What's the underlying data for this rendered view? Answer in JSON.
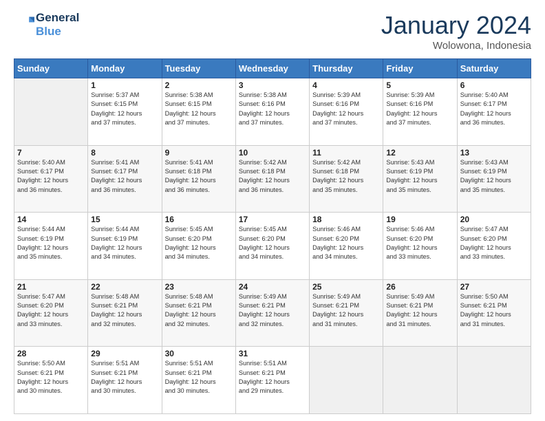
{
  "header": {
    "logo_line1": "General",
    "logo_line2": "Blue",
    "month_title": "January 2024",
    "location": "Wolowona, Indonesia"
  },
  "days_of_week": [
    "Sunday",
    "Monday",
    "Tuesday",
    "Wednesday",
    "Thursday",
    "Friday",
    "Saturday"
  ],
  "weeks": [
    [
      {
        "day": "",
        "info": ""
      },
      {
        "day": "1",
        "info": "Sunrise: 5:37 AM\nSunset: 6:15 PM\nDaylight: 12 hours\nand 37 minutes."
      },
      {
        "day": "2",
        "info": "Sunrise: 5:38 AM\nSunset: 6:15 PM\nDaylight: 12 hours\nand 37 minutes."
      },
      {
        "day": "3",
        "info": "Sunrise: 5:38 AM\nSunset: 6:16 PM\nDaylight: 12 hours\nand 37 minutes."
      },
      {
        "day": "4",
        "info": "Sunrise: 5:39 AM\nSunset: 6:16 PM\nDaylight: 12 hours\nand 37 minutes."
      },
      {
        "day": "5",
        "info": "Sunrise: 5:39 AM\nSunset: 6:16 PM\nDaylight: 12 hours\nand 37 minutes."
      },
      {
        "day": "6",
        "info": "Sunrise: 5:40 AM\nSunset: 6:17 PM\nDaylight: 12 hours\nand 36 minutes."
      }
    ],
    [
      {
        "day": "7",
        "info": "Sunrise: 5:40 AM\nSunset: 6:17 PM\nDaylight: 12 hours\nand 36 minutes."
      },
      {
        "day": "8",
        "info": "Sunrise: 5:41 AM\nSunset: 6:17 PM\nDaylight: 12 hours\nand 36 minutes."
      },
      {
        "day": "9",
        "info": "Sunrise: 5:41 AM\nSunset: 6:18 PM\nDaylight: 12 hours\nand 36 minutes."
      },
      {
        "day": "10",
        "info": "Sunrise: 5:42 AM\nSunset: 6:18 PM\nDaylight: 12 hours\nand 36 minutes."
      },
      {
        "day": "11",
        "info": "Sunrise: 5:42 AM\nSunset: 6:18 PM\nDaylight: 12 hours\nand 35 minutes."
      },
      {
        "day": "12",
        "info": "Sunrise: 5:43 AM\nSunset: 6:19 PM\nDaylight: 12 hours\nand 35 minutes."
      },
      {
        "day": "13",
        "info": "Sunrise: 5:43 AM\nSunset: 6:19 PM\nDaylight: 12 hours\nand 35 minutes."
      }
    ],
    [
      {
        "day": "14",
        "info": "Sunrise: 5:44 AM\nSunset: 6:19 PM\nDaylight: 12 hours\nand 35 minutes."
      },
      {
        "day": "15",
        "info": "Sunrise: 5:44 AM\nSunset: 6:19 PM\nDaylight: 12 hours\nand 34 minutes."
      },
      {
        "day": "16",
        "info": "Sunrise: 5:45 AM\nSunset: 6:20 PM\nDaylight: 12 hours\nand 34 minutes."
      },
      {
        "day": "17",
        "info": "Sunrise: 5:45 AM\nSunset: 6:20 PM\nDaylight: 12 hours\nand 34 minutes."
      },
      {
        "day": "18",
        "info": "Sunrise: 5:46 AM\nSunset: 6:20 PM\nDaylight: 12 hours\nand 34 minutes."
      },
      {
        "day": "19",
        "info": "Sunrise: 5:46 AM\nSunset: 6:20 PM\nDaylight: 12 hours\nand 33 minutes."
      },
      {
        "day": "20",
        "info": "Sunrise: 5:47 AM\nSunset: 6:20 PM\nDaylight: 12 hours\nand 33 minutes."
      }
    ],
    [
      {
        "day": "21",
        "info": "Sunrise: 5:47 AM\nSunset: 6:20 PM\nDaylight: 12 hours\nand 33 minutes."
      },
      {
        "day": "22",
        "info": "Sunrise: 5:48 AM\nSunset: 6:21 PM\nDaylight: 12 hours\nand 32 minutes."
      },
      {
        "day": "23",
        "info": "Sunrise: 5:48 AM\nSunset: 6:21 PM\nDaylight: 12 hours\nand 32 minutes."
      },
      {
        "day": "24",
        "info": "Sunrise: 5:49 AM\nSunset: 6:21 PM\nDaylight: 12 hours\nand 32 minutes."
      },
      {
        "day": "25",
        "info": "Sunrise: 5:49 AM\nSunset: 6:21 PM\nDaylight: 12 hours\nand 31 minutes."
      },
      {
        "day": "26",
        "info": "Sunrise: 5:49 AM\nSunset: 6:21 PM\nDaylight: 12 hours\nand 31 minutes."
      },
      {
        "day": "27",
        "info": "Sunrise: 5:50 AM\nSunset: 6:21 PM\nDaylight: 12 hours\nand 31 minutes."
      }
    ],
    [
      {
        "day": "28",
        "info": "Sunrise: 5:50 AM\nSunset: 6:21 PM\nDaylight: 12 hours\nand 30 minutes."
      },
      {
        "day": "29",
        "info": "Sunrise: 5:51 AM\nSunset: 6:21 PM\nDaylight: 12 hours\nand 30 minutes."
      },
      {
        "day": "30",
        "info": "Sunrise: 5:51 AM\nSunset: 6:21 PM\nDaylight: 12 hours\nand 30 minutes."
      },
      {
        "day": "31",
        "info": "Sunrise: 5:51 AM\nSunset: 6:21 PM\nDaylight: 12 hours\nand 29 minutes."
      },
      {
        "day": "",
        "info": ""
      },
      {
        "day": "",
        "info": ""
      },
      {
        "day": "",
        "info": ""
      }
    ]
  ]
}
